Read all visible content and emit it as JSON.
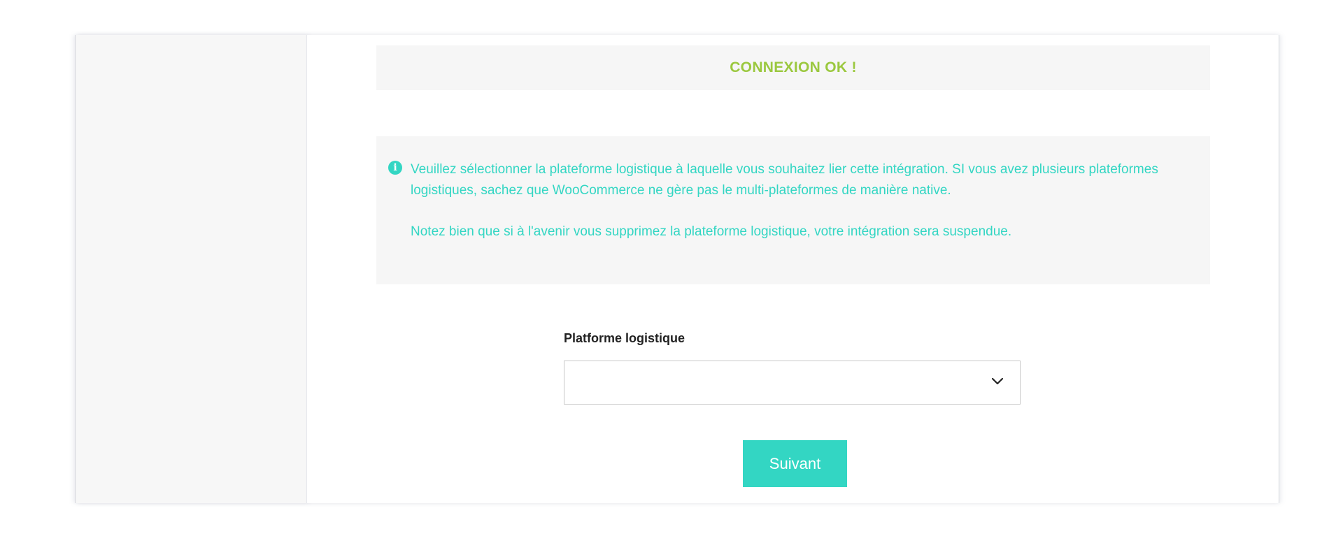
{
  "status": {
    "text": "CONNEXION OK !",
    "color": "#9bc83f"
  },
  "info": {
    "icon": "info-circle-icon",
    "color": "#33d6c3",
    "paragraph_1": "Veuillez sélectionner la plateforme logistique à laquelle vous souhaitez lier cette intégration. SI vous avez plusieurs plateformes logistiques, sachez que WooCommerce ne gère pas le multi-plateformes de manière native.",
    "paragraph_2": "Notez bien que si à l'avenir vous supprimez la plateforme logistique, votre intégration sera suspendue."
  },
  "form": {
    "platform_label": "Platforme logistique",
    "platform_selected": "",
    "platform_icon": "chevron-down-icon",
    "next_button_label": "Suivant",
    "accent_color": "#33d6c3"
  }
}
